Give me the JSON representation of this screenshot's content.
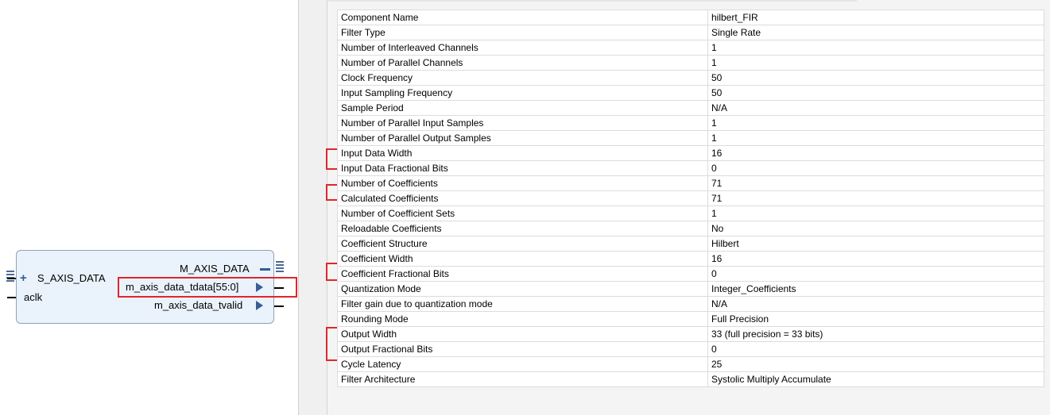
{
  "block": {
    "slave_bus": "S_AXIS_DATA",
    "clock_port": "aclk",
    "master_bus": "M_AXIS_DATA",
    "tdata_port": "m_axis_data_tdata[55:0]",
    "tvalid_port": "m_axis_data_tvalid",
    "expand_symbol": "+"
  },
  "colors": {
    "highlight": "#e0262b",
    "block_fill": "#eaf2fb",
    "port_arrow": "#3a5e93"
  },
  "table": {
    "rows": [
      {
        "name": "Component Name",
        "value": "hilbert_FIR"
      },
      {
        "name": "Filter Type",
        "value": "Single Rate"
      },
      {
        "name": "Number of Interleaved Channels",
        "value": "1"
      },
      {
        "name": "Number of Parallel Channels",
        "value": "1"
      },
      {
        "name": "Clock Frequency",
        "value": "50"
      },
      {
        "name": "Input Sampling Frequency",
        "value": "50"
      },
      {
        "name": "Sample Period",
        "value": "N/A"
      },
      {
        "name": "Number of Parallel Input Samples",
        "value": "1"
      },
      {
        "name": "Number of Parallel Output Samples",
        "value": "1"
      },
      {
        "name": "Input Data Width",
        "value": "16"
      },
      {
        "name": "Input Data Fractional Bits",
        "value": "0"
      },
      {
        "name": "Number of Coefficients",
        "value": "71"
      },
      {
        "name": "Calculated Coefficients",
        "value": "71"
      },
      {
        "name": "Number of Coefficient Sets",
        "value": "1"
      },
      {
        "name": "Reloadable Coefficients",
        "value": "No"
      },
      {
        "name": "Coefficient Structure",
        "value": "Hilbert"
      },
      {
        "name": "Coefficient Width",
        "value": "16"
      },
      {
        "name": "Coefficient Fractional Bits",
        "value": "0"
      },
      {
        "name": "Quantization Mode",
        "value": "Integer_Coefficients"
      },
      {
        "name": "Filter gain due to quantization mode",
        "value": "N/A"
      },
      {
        "name": "Rounding Mode",
        "value": "Full Precision"
      },
      {
        "name": "Output Width",
        "value": "33 (full precision = 33 bits)"
      },
      {
        "name": "Output Fractional Bits",
        "value": "0"
      },
      {
        "name": "Cycle Latency",
        "value": "25"
      },
      {
        "name": "Filter Architecture",
        "value": "Systolic Multiply Accumulate"
      }
    ]
  }
}
